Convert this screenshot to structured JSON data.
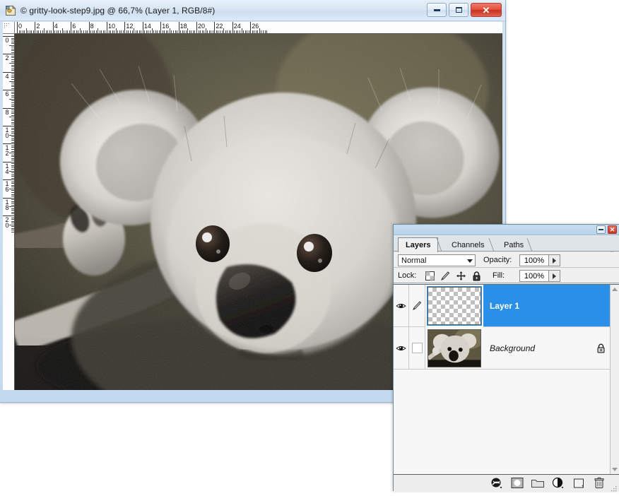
{
  "document_window": {
    "icon": "photoshop-document-icon",
    "title": "© gritty-look-step9.jpg @ 66,7% (Layer 1, RGB/8#)",
    "filename": "gritty-look-step9.jpg",
    "zoom": "66,7%",
    "active_layer": "Layer 1",
    "color_mode": "RGB/8#",
    "window_buttons": {
      "minimize": "–",
      "maximize": "□",
      "close": "✕"
    },
    "rulers": {
      "unit_step": 2,
      "horizontal_labels": [
        "0",
        "2",
        "4",
        "6",
        "8",
        "10",
        "12",
        "14",
        "16",
        "18",
        "20",
        "22",
        "24",
        "26"
      ],
      "vertical_labels": [
        "0",
        "2",
        "4",
        "6",
        "8",
        "10",
        "12",
        "14",
        "16",
        "18",
        "20"
      ]
    },
    "canvas_content": "koala-photograph"
  },
  "layers_panel": {
    "window_buttons": {
      "minimize": "–",
      "close": "✕"
    },
    "tabs": [
      {
        "label": "Layers",
        "active": true
      },
      {
        "label": "Channels",
        "active": false
      },
      {
        "label": "Paths",
        "active": false
      }
    ],
    "menu_arrow": "»",
    "blend": {
      "mode": "Normal",
      "opacity_label": "Opacity:",
      "opacity_value": "100%"
    },
    "lock": {
      "label": "Lock:",
      "icons": [
        "lock-transparency-icon",
        "lock-image-pixels-icon",
        "lock-position-icon",
        "lock-all-icon"
      ],
      "fill_label": "Fill:",
      "fill_value": "100%"
    },
    "layers": [
      {
        "name": "Layer 1",
        "visible": true,
        "selected": true,
        "thumbnail": "transparent-checkerboard",
        "second_icon": "brush-icon",
        "locked": false,
        "italic": false
      },
      {
        "name": "Background",
        "visible": true,
        "selected": false,
        "thumbnail": "koala-photograph",
        "second_icon": "empty-box",
        "locked": true,
        "italic": true
      }
    ],
    "footer_buttons": [
      "link-layers-icon",
      "add-layer-style-icon",
      "add-layer-mask-icon",
      "new-fill-adjustment-layer-icon",
      "new-group-icon",
      "new-layer-icon",
      "delete-layer-icon"
    ],
    "scrollbar": {
      "up": "▲",
      "down": "▼"
    }
  },
  "colors": {
    "selection_blue": "#2a8fe8",
    "titlebar_blue": "#d8e6f4",
    "panel_grey": "#ededed",
    "close_red": "#c8301c"
  }
}
